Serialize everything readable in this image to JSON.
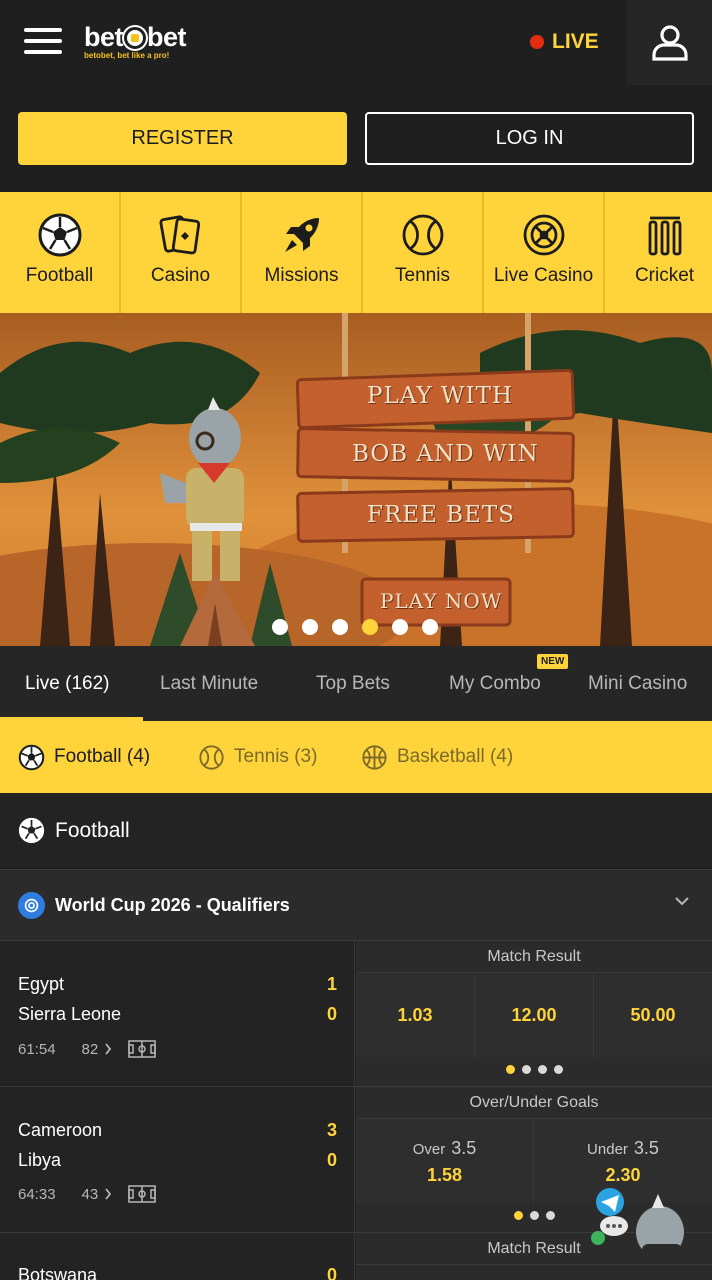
{
  "header": {
    "brand_left": "bet",
    "brand_right": "bet",
    "tagline": "betobet, bet like a pro!",
    "live_label": "LIVE"
  },
  "auth": {
    "register_label": "REGISTER",
    "login_label": "LOG IN"
  },
  "categories": [
    {
      "label": "Football",
      "icon": "football-icon"
    },
    {
      "label": "Casino",
      "icon": "cards-icon"
    },
    {
      "label": "Missions",
      "icon": "rocket-icon"
    },
    {
      "label": "Tennis",
      "icon": "tennis-ball-icon"
    },
    {
      "label": "Live Casino",
      "icon": "roulette-icon"
    },
    {
      "label": "Cricket",
      "icon": "cricket-wickets-icon"
    }
  ],
  "banner": {
    "line1": "PLAY WITH",
    "line2": "BOB AND WIN",
    "line3": "FREE BETS",
    "cta": "PLAY NOW",
    "slide_count": 6,
    "active_slide": 4
  },
  "tabs": [
    {
      "label": "Live (162)"
    },
    {
      "label": "Last Minute"
    },
    {
      "label": "Top Bets"
    },
    {
      "label": "My Combo"
    },
    {
      "label": "Mini Casino"
    }
  ],
  "new_badge": "NEW",
  "sports": [
    {
      "label": "Football (4)"
    },
    {
      "label": "Tennis (3)"
    },
    {
      "label": "Basketball (4)"
    }
  ],
  "section_title": "Football",
  "league": "World Cup 2026 - Qualifiers",
  "matches": [
    {
      "home": "Egypt",
      "away": "Sierra Leone",
      "home_score": "1",
      "away_score": "0",
      "time": "61:54",
      "more": "82",
      "market": "Match Result",
      "odds": [
        "1.03",
        "12.00",
        "50.00"
      ]
    },
    {
      "home": "Cameroon",
      "away": "Libya",
      "home_score": "3",
      "away_score": "0",
      "time": "64:33",
      "more": "43",
      "market": "Over/Under Goals",
      "over_label": "Over",
      "over_line": "3.5",
      "over_odds": "1.58",
      "under_label": "Under",
      "under_line": "3.5",
      "under_odds": "2.30"
    },
    {
      "home": "Botswana",
      "home_score": "0",
      "market": "Match Result"
    }
  ],
  "colors": {
    "accent": "#ffd43b",
    "background": "#1f1f1f",
    "live_dot": "#e52b12"
  }
}
